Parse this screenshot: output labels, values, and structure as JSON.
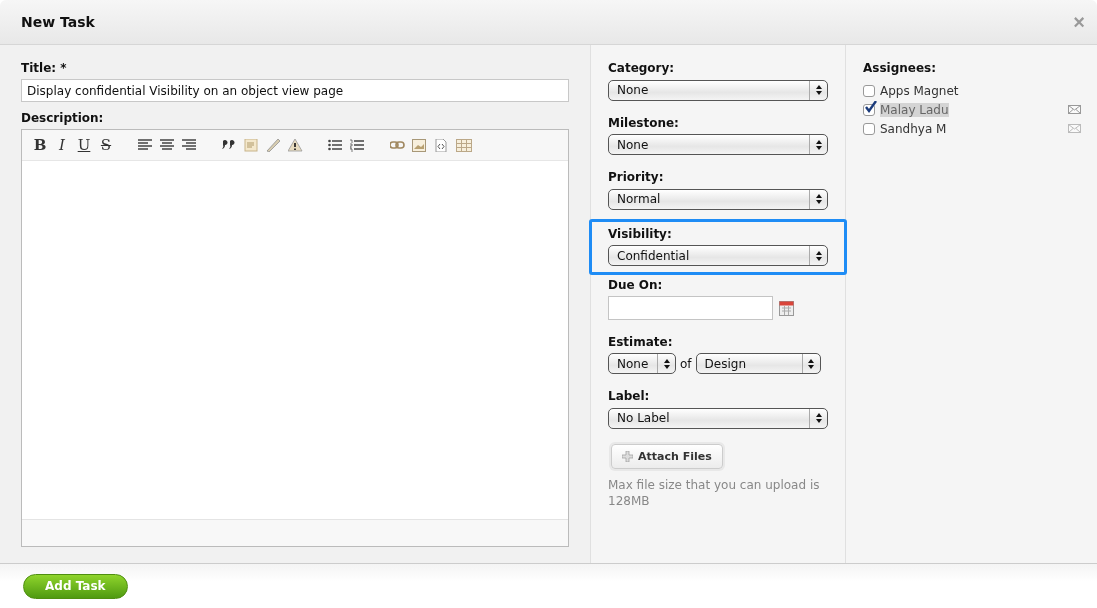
{
  "window": {
    "title": "New Task",
    "close": "×"
  },
  "title_field": {
    "label": "Title: *",
    "value": "Display confidential Visibility on an object view page"
  },
  "description": {
    "label": "Description:",
    "toolbar": [
      {
        "kind": "bold",
        "label": "B"
      },
      {
        "kind": "italic",
        "label": "I"
      },
      {
        "kind": "underline",
        "label": "U"
      },
      {
        "kind": "strike",
        "label": "S"
      },
      {
        "kind": "align-left"
      },
      {
        "kind": "align-center"
      },
      {
        "kind": "align-right"
      },
      {
        "kind": "quote"
      },
      {
        "kind": "note"
      },
      {
        "kind": "pencil"
      },
      {
        "kind": "warning"
      },
      {
        "kind": "bullets"
      },
      {
        "kind": "numbers"
      },
      {
        "kind": "link"
      },
      {
        "kind": "image"
      },
      {
        "kind": "code"
      },
      {
        "kind": "table"
      }
    ]
  },
  "fields": [
    {
      "kind": "select",
      "label": "Category:",
      "value": "None",
      "highlighted": false
    },
    {
      "kind": "select",
      "label": "Milestone:",
      "value": "None",
      "highlighted": false
    },
    {
      "kind": "select",
      "label": "Priority:",
      "value": "Normal",
      "highlighted": false
    },
    {
      "kind": "select",
      "label": "Visibility:",
      "value": "Confidential",
      "highlighted": true
    },
    {
      "kind": "date",
      "label": "Due On:",
      "highlighted": false
    },
    {
      "kind": "estimate",
      "label": "Estimate:",
      "value": "None",
      "joiner": "of",
      "value2": "Design",
      "highlighted": false
    },
    {
      "kind": "select",
      "label": "Label:",
      "value": "No Label",
      "highlighted": false
    }
  ],
  "attach": {
    "button": "Attach Files",
    "note": "Max file size that you can upload is 128MB"
  },
  "assignees": {
    "label": "Assignees:",
    "items": [
      {
        "name": "Apps Magnet",
        "checked": false,
        "highlighted": false,
        "mail": false
      },
      {
        "name": "Malay Ladu",
        "checked": true,
        "highlighted": true,
        "mail": true
      },
      {
        "name": "Sandhya M",
        "checked": false,
        "highlighted": false,
        "mail": true
      }
    ]
  },
  "footer": {
    "button": "Add Task"
  }
}
